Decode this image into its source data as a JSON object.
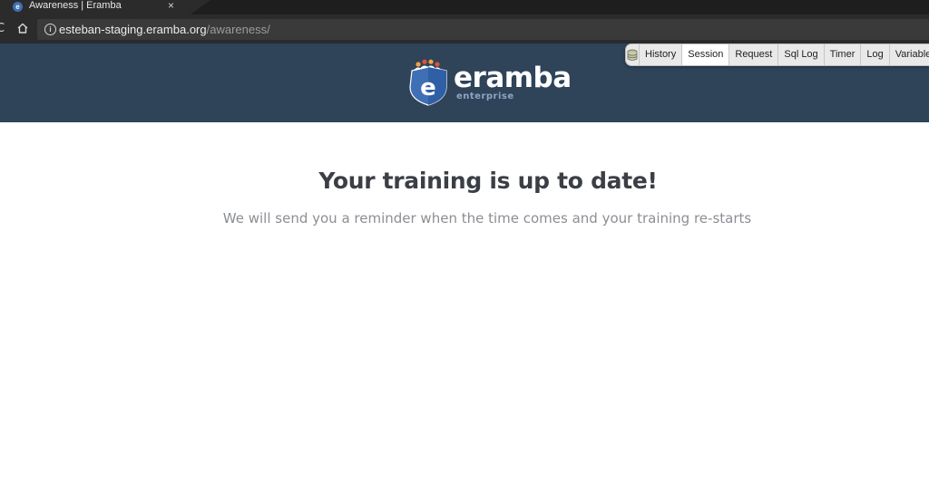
{
  "browser": {
    "tab_title": "Awareness | Eramba",
    "tab_close": "×",
    "favicon_letter": "e",
    "url_host": "esteban-staging.eramba.org",
    "url_path": "/awareness/",
    "info_glyph": "i",
    "reload_glyph": "C"
  },
  "header": {
    "brand_name": "eramba",
    "brand_edition": "enterprise",
    "colors": {
      "background": "#2f4359",
      "shield": "#3f6fb5"
    }
  },
  "debug_toolbar": {
    "icon": "database-icon",
    "items": [
      {
        "label": "History",
        "active": false
      },
      {
        "label": "Session",
        "active": true
      },
      {
        "label": "Request",
        "active": false
      },
      {
        "label": "Sql Log",
        "active": false
      },
      {
        "label": "Timer",
        "active": false
      },
      {
        "label": "Log",
        "active": false
      },
      {
        "label": "Variables",
        "active": false
      }
    ]
  },
  "main": {
    "heading": "Your training is up to date!",
    "subtext": "We will send you a reminder when the time comes and your training re-starts"
  }
}
